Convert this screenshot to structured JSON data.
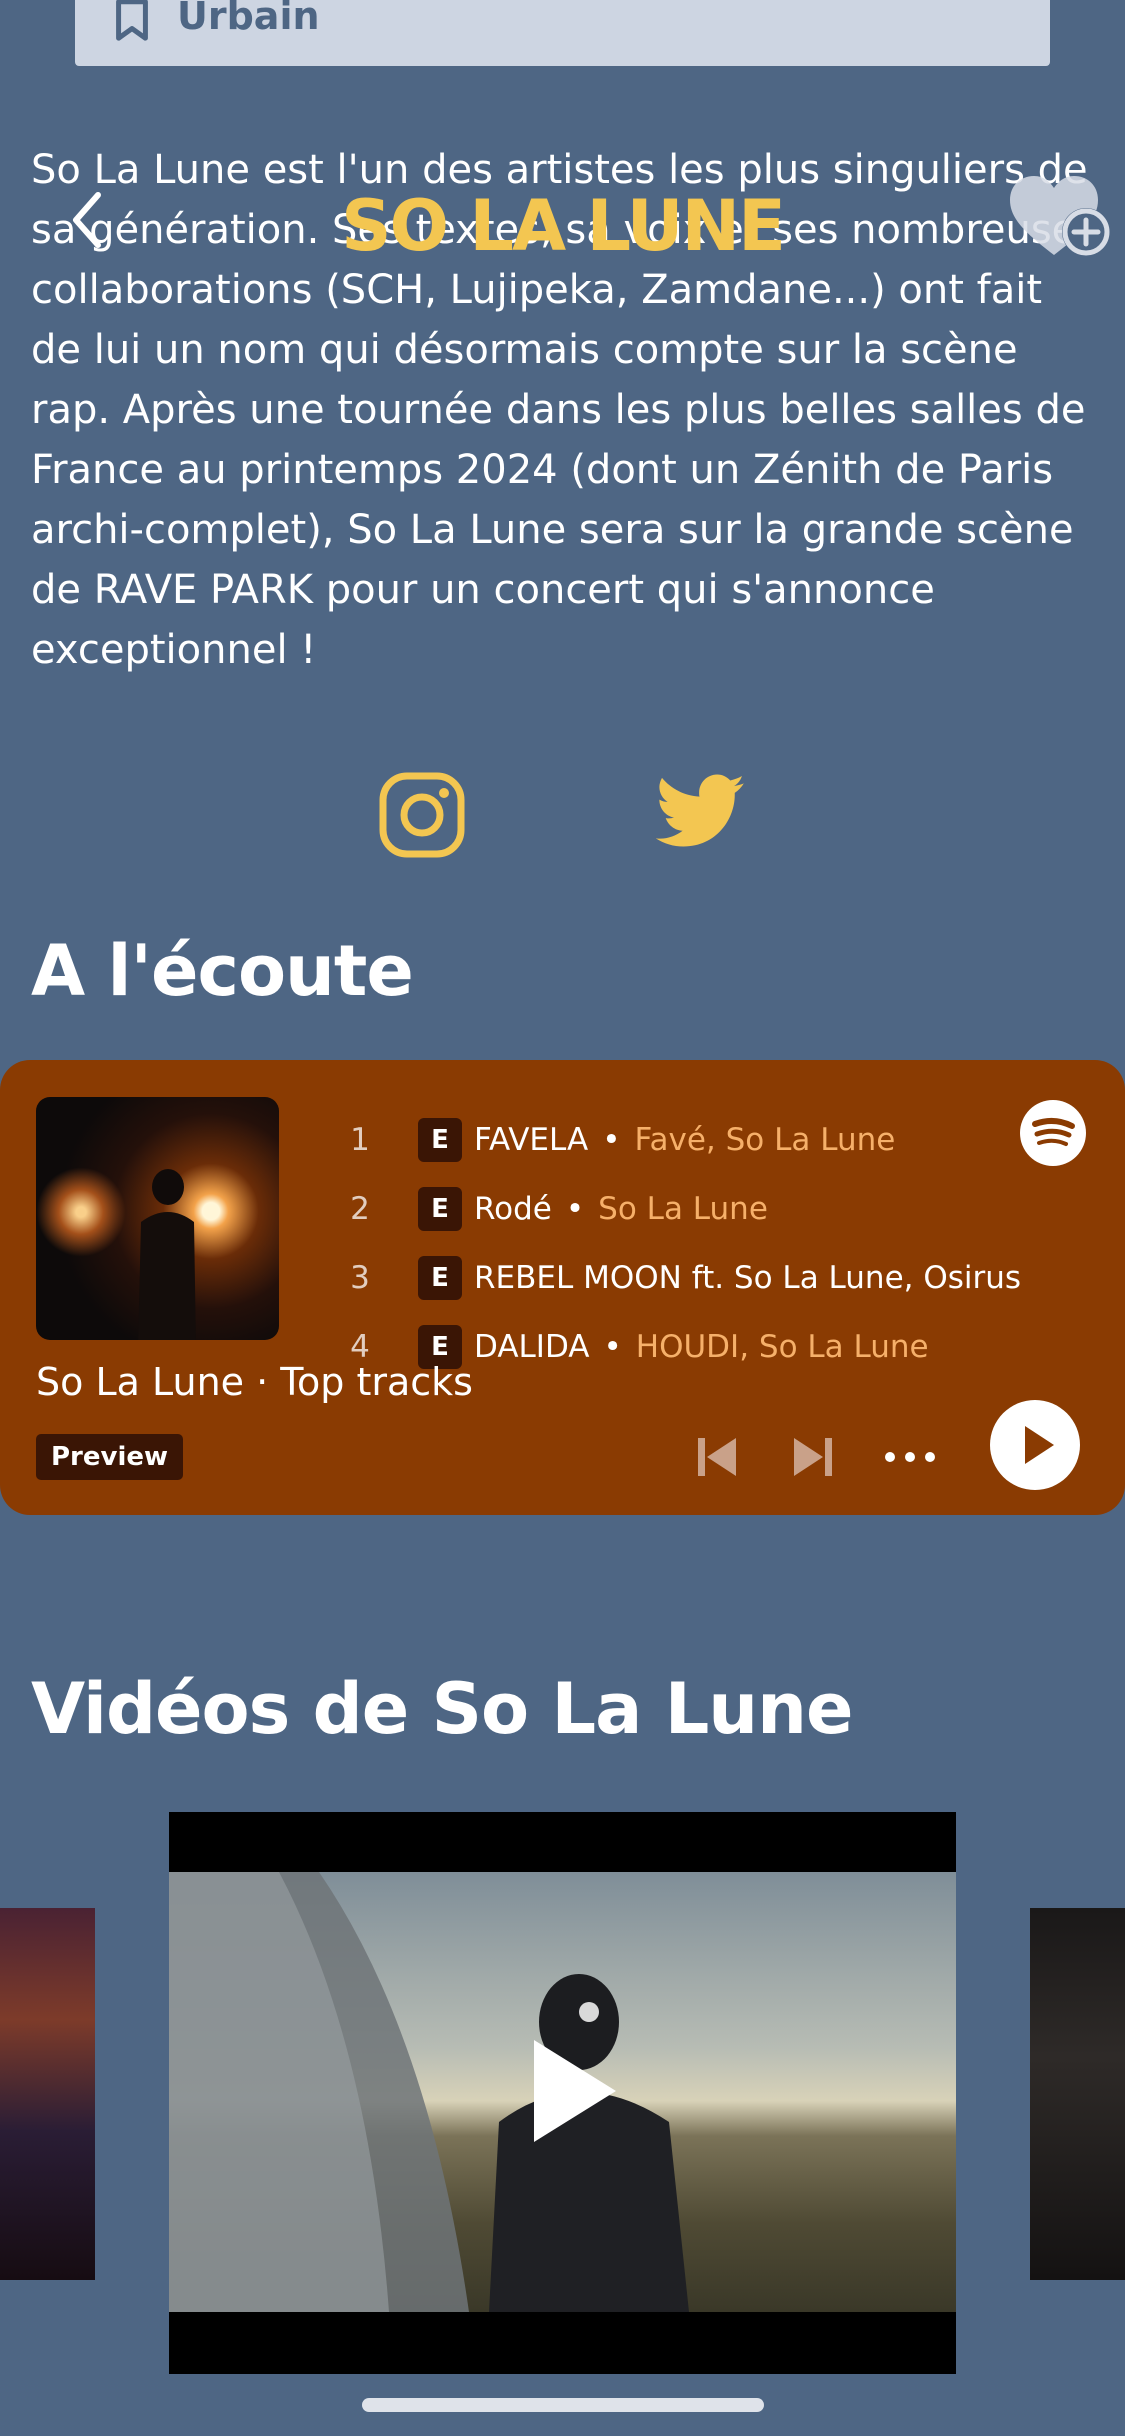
{
  "tag": {
    "label": "Urbain"
  },
  "header": {
    "title": "SO LA LUNE"
  },
  "description": {
    "text": "So La Lune est l'un des artistes les plus singuliers de sa génération. Ses textes, sa voix et ses nombreuses collaborations (SCH, Lujipeka, Zamdane...) ont fait de lui un nom qui désormais compte sur la scène rap. Après une tournée dans les plus belles salles de France au printemps 2024 (dont un Zénith de Paris archi-complet), So La Lune sera sur la grande scène de RAVE PARK pour un concert qui s'annonce exceptionnel !"
  },
  "socials": {
    "instagram": "instagram-icon",
    "twitter": "twitter-icon"
  },
  "listening": {
    "section_title": "A l'écoute",
    "card_title": "So La Lune · Top tracks",
    "preview_label": "Preview",
    "tracks": [
      {
        "num": "1",
        "badge": "E",
        "title": "FAVELA",
        "artist": "Favé, So La Lune"
      },
      {
        "num": "2",
        "badge": "E",
        "title": "Rodé",
        "artist": "So La Lune"
      },
      {
        "num": "3",
        "badge": "E",
        "title": "REBEL MOON ft. So La Lune, Osirus",
        "artist": ""
      },
      {
        "num": "4",
        "badge": "E",
        "title": "DALIDA",
        "artist": "HOUDI, So La Lune"
      }
    ]
  },
  "videos": {
    "section_title": "Vidéos de So La Lune"
  },
  "colors": {
    "background": "#4e6684",
    "accent": "#f3c651",
    "spotify_card": "#8a3b02"
  }
}
